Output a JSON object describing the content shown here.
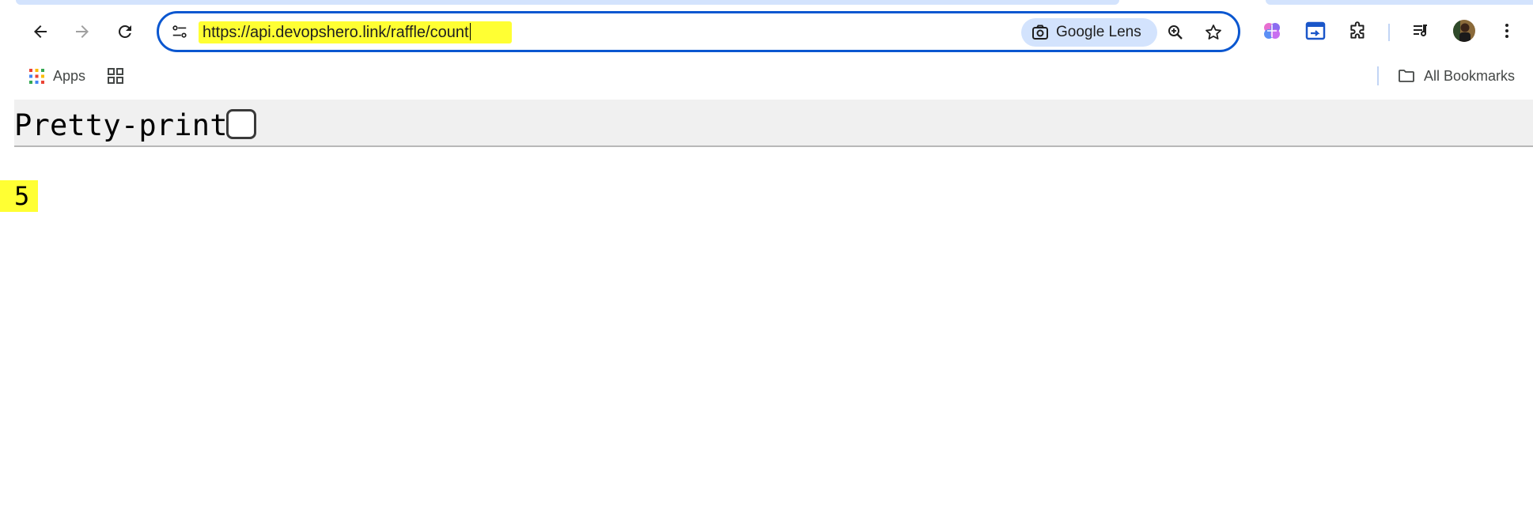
{
  "browser": {
    "address_bar": {
      "url": "https://api.devopshero.link/raffle/count",
      "lens_label": "Google Lens"
    },
    "nav_icons": [
      "back-arrow-icon",
      "forward-arrow-icon",
      "reload-icon"
    ],
    "bookmarks": {
      "apps_label": "Apps",
      "all_bookmarks_label": "All Bookmarks"
    },
    "colors": {
      "accent": "#0b57d0",
      "chip": "#d3e3fd",
      "highlight": "#ffff33"
    }
  },
  "page": {
    "pretty_print_label": "Pretty-print",
    "pretty_print_checked": false,
    "json_value": "5"
  }
}
